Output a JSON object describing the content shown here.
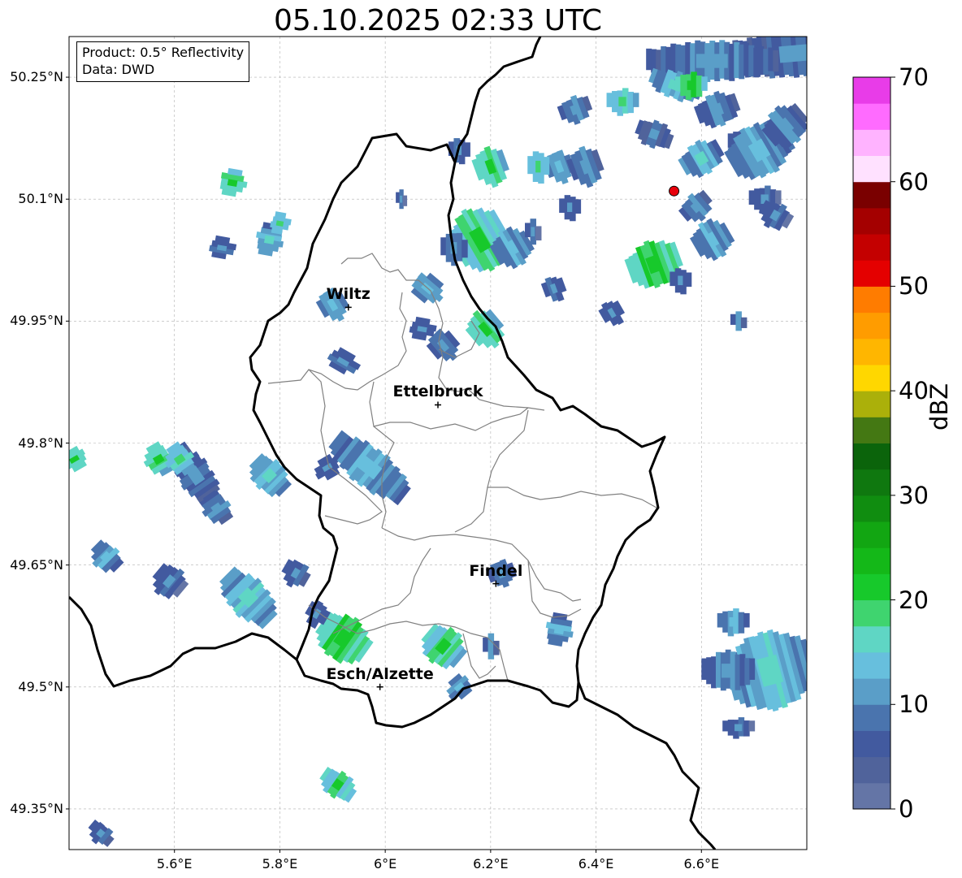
{
  "title": "05.10.2025 02:33 UTC",
  "info": {
    "product_line": "Product: 0.5° Reflectivity",
    "data_line": "Data: DWD"
  },
  "extent": {
    "lon_min": 5.4,
    "lon_max": 6.8,
    "lat_min": 49.3,
    "lat_max": 50.3
  },
  "lat_ticks": [
    {
      "value": 50.25,
      "label": "50.25°N"
    },
    {
      "value": 50.1,
      "label": "50.1°N"
    },
    {
      "value": 49.95,
      "label": "49.95°N"
    },
    {
      "value": 49.8,
      "label": "49.8°N"
    },
    {
      "value": 49.65,
      "label": "49.65°N"
    },
    {
      "value": 49.5,
      "label": "49.5°N"
    },
    {
      "value": 49.35,
      "label": "49.35°N"
    }
  ],
  "lon_ticks": [
    {
      "value": 5.6,
      "label": "5.6°E"
    },
    {
      "value": 5.8,
      "label": "5.8°E"
    },
    {
      "value": 6.0,
      "label": "6°E"
    },
    {
      "value": 6.2,
      "label": "6.2°E"
    },
    {
      "value": 6.4,
      "label": "6.4°E"
    },
    {
      "value": 6.6,
      "label": "6.6°E"
    }
  ],
  "cities": [
    {
      "name": "Wiltz",
      "lon": 5.93,
      "lat": 49.967
    },
    {
      "name": "Ettelbruck",
      "lon": 6.1,
      "lat": 49.847
    },
    {
      "name": "Findel",
      "lon": 6.21,
      "lat": 49.627
    },
    {
      "name": "Esch/Alzette",
      "lon": 5.99,
      "lat": 49.5
    }
  ],
  "radar_site": {
    "lon": 6.548,
    "lat": 50.11,
    "color": "#e8000b"
  },
  "colorbar": {
    "label": "dBZ",
    "min": 0,
    "max": 70,
    "step": 2.5,
    "ticks": [
      {
        "value": 0,
        "label": "0"
      },
      {
        "value": 10,
        "label": "10"
      },
      {
        "value": 20,
        "label": "20"
      },
      {
        "value": 30,
        "label": "30"
      },
      {
        "value": 40,
        "label": "40"
      },
      {
        "value": 50,
        "label": "50"
      },
      {
        "value": 60,
        "label": "60"
      },
      {
        "value": 70,
        "label": "70"
      }
    ],
    "colors": [
      "#6475a6",
      "#50639b",
      "#425a9f",
      "#4a74ae",
      "#5a9ec8",
      "#67bfdd",
      "#5fd6c4",
      "#3fd46f",
      "#17c92b",
      "#14b818",
      "#12a612",
      "#108d10",
      "#0f780f",
      "#0b640b",
      "#447813",
      "#abb00a",
      "#ffd700",
      "#ffb600",
      "#ff9c00",
      "#ff7c00",
      "#e40000",
      "#c40000",
      "#a40000",
      "#7a0000",
      "#ffe1ff",
      "#ffb3ff",
      "#ff6bff",
      "#e83ce8"
    ]
  },
  "radar_echoes": [
    {
      "lon": 6.79,
      "lat": 50.28,
      "len": 0.35,
      "wid": 0.035,
      "ang": 5,
      "dbz": 10
    },
    {
      "lon": 6.62,
      "lat": 50.27,
      "len": 0.25,
      "wid": 0.03,
      "ang": 0,
      "dbz": 12
    },
    {
      "lon": 6.55,
      "lat": 50.24,
      "len": 0.1,
      "wid": 0.02,
      "ang": -20,
      "dbz": 15
    },
    {
      "lon": 6.45,
      "lat": 50.22,
      "len": 0.06,
      "wid": 0.02,
      "ang": 0,
      "dbz": 18
    },
    {
      "lon": 6.36,
      "lat": 50.21,
      "len": 0.06,
      "wid": 0.02,
      "ang": 20,
      "dbz": 12
    },
    {
      "lon": 6.51,
      "lat": 50.18,
      "len": 0.07,
      "wid": 0.02,
      "ang": -20,
      "dbz": 10
    },
    {
      "lon": 6.63,
      "lat": 50.21,
      "len": 0.08,
      "wid": 0.025,
      "ang": 20,
      "dbz": 12
    },
    {
      "lon": 6.58,
      "lat": 50.24,
      "len": 0.06,
      "wid": 0.02,
      "ang": 0,
      "dbz": 22
    },
    {
      "lon": 6.6,
      "lat": 50.15,
      "len": 0.08,
      "wid": 0.025,
      "ang": 30,
      "dbz": 15
    },
    {
      "lon": 6.68,
      "lat": 50.17,
      "len": 0.06,
      "wid": 0.02,
      "ang": 0,
      "dbz": 10
    },
    {
      "lon": 6.71,
      "lat": 50.16,
      "len": 0.12,
      "wid": 0.04,
      "ang": 30,
      "dbz": 14
    },
    {
      "lon": 6.76,
      "lat": 50.19,
      "len": 0.08,
      "wid": 0.03,
      "ang": 40,
      "dbz": 12
    },
    {
      "lon": 6.72,
      "lat": 50.1,
      "len": 0.06,
      "wid": 0.02,
      "ang": 0,
      "dbz": 10
    },
    {
      "lon": 6.74,
      "lat": 50.08,
      "len": 0.06,
      "wid": 0.02,
      "ang": -30,
      "dbz": 10
    },
    {
      "lon": 6.2,
      "lat": 50.14,
      "len": 0.06,
      "wid": 0.03,
      "ang": 20,
      "dbz": 20
    },
    {
      "lon": 6.14,
      "lat": 50.16,
      "len": 0.04,
      "wid": 0.02,
      "ang": 0,
      "dbz": 12
    },
    {
      "lon": 6.33,
      "lat": 50.14,
      "len": 0.05,
      "wid": 0.025,
      "ang": 20,
      "dbz": 14
    },
    {
      "lon": 6.38,
      "lat": 50.14,
      "len": 0.06,
      "wid": 0.03,
      "ang": 20,
      "dbz": 12
    },
    {
      "lon": 6.29,
      "lat": 50.14,
      "len": 0.04,
      "wid": 0.025,
      "ang": 0,
      "dbz": 18
    },
    {
      "lon": 6.35,
      "lat": 50.09,
      "len": 0.04,
      "wid": 0.02,
      "ang": 0,
      "dbz": 10
    },
    {
      "lon": 6.59,
      "lat": 50.09,
      "len": 0.06,
      "wid": 0.02,
      "ang": 40,
      "dbz": 12
    },
    {
      "lon": 6.62,
      "lat": 50.05,
      "len": 0.07,
      "wid": 0.03,
      "ang": 30,
      "dbz": 14
    },
    {
      "lon": 6.51,
      "lat": 50.02,
      "len": 0.1,
      "wid": 0.035,
      "ang": 20,
      "dbz": 22
    },
    {
      "lon": 6.18,
      "lat": 50.05,
      "len": 0.1,
      "wid": 0.05,
      "ang": 30,
      "dbz": 20
    },
    {
      "lon": 6.24,
      "lat": 50.04,
      "len": 0.07,
      "wid": 0.03,
      "ang": 30,
      "dbz": 14
    },
    {
      "lon": 6.13,
      "lat": 50.04,
      "len": 0.05,
      "wid": 0.025,
      "ang": 0,
      "dbz": 12
    },
    {
      "lon": 6.28,
      "lat": 50.06,
      "len": 0.03,
      "wid": 0.02,
      "ang": 0,
      "dbz": 10
    },
    {
      "lon": 6.32,
      "lat": 49.99,
      "len": 0.04,
      "wid": 0.02,
      "ang": 20,
      "dbz": 12
    },
    {
      "lon": 6.43,
      "lat": 49.96,
      "len": 0.04,
      "wid": 0.02,
      "ang": 30,
      "dbz": 10
    },
    {
      "lon": 6.56,
      "lat": 50.0,
      "len": 0.04,
      "wid": 0.02,
      "ang": 0,
      "dbz": 10
    },
    {
      "lon": 6.67,
      "lat": 49.95,
      "len": 0.03,
      "wid": 0.015,
      "ang": 0,
      "dbz": 12
    },
    {
      "lon": 6.03,
      "lat": 50.1,
      "len": 0.02,
      "wid": 0.015,
      "ang": 0,
      "dbz": 10
    },
    {
      "lon": 6.19,
      "lat": 49.94,
      "len": 0.06,
      "wid": 0.03,
      "ang": 40,
      "dbz": 20
    },
    {
      "lon": 6.08,
      "lat": 49.99,
      "len": 0.05,
      "wid": 0.025,
      "ang": 50,
      "dbz": 14
    },
    {
      "lon": 6.11,
      "lat": 49.92,
      "len": 0.05,
      "wid": 0.025,
      "ang": 40,
      "dbz": 12
    },
    {
      "lon": 6.07,
      "lat": 49.94,
      "len": 0.04,
      "wid": 0.02,
      "ang": 80,
      "dbz": 10
    },
    {
      "lon": 5.9,
      "lat": 49.97,
      "len": 0.05,
      "wid": 0.025,
      "ang": 30,
      "dbz": 14
    },
    {
      "lon": 5.92,
      "lat": 49.9,
      "len": 0.04,
      "wid": 0.025,
      "ang": 60,
      "dbz": 12
    },
    {
      "lon": 5.71,
      "lat": 50.12,
      "len": 0.05,
      "wid": 0.02,
      "ang": 80,
      "dbz": 20
    },
    {
      "lon": 5.69,
      "lat": 50.04,
      "len": 0.04,
      "wid": 0.02,
      "ang": 80,
      "dbz": 12
    },
    {
      "lon": 5.78,
      "lat": 50.05,
      "len": 0.06,
      "wid": 0.02,
      "ang": 80,
      "dbz": 15
    },
    {
      "lon": 5.8,
      "lat": 50.07,
      "len": 0.04,
      "wid": 0.015,
      "ang": 80,
      "dbz": 18
    },
    {
      "lon": 5.97,
      "lat": 49.77,
      "len": 0.17,
      "wid": 0.03,
      "ang": -38,
      "dbz": 14
    },
    {
      "lon": 5.78,
      "lat": 49.76,
      "len": 0.08,
      "wid": 0.025,
      "ang": -45,
      "dbz": 16
    },
    {
      "lon": 5.89,
      "lat": 49.77,
      "len": 0.04,
      "wid": 0.02,
      "ang": -60,
      "dbz": 10
    },
    {
      "lon": 5.64,
      "lat": 49.76,
      "len": 0.13,
      "wid": 0.025,
      "ang": -55,
      "dbz": 10
    },
    {
      "lon": 5.57,
      "lat": 49.78,
      "len": 0.06,
      "wid": 0.02,
      "ang": -60,
      "dbz": 20
    },
    {
      "lon": 5.61,
      "lat": 49.78,
      "len": 0.06,
      "wid": 0.02,
      "ang": -55,
      "dbz": 18
    },
    {
      "lon": 5.68,
      "lat": 49.72,
      "len": 0.06,
      "wid": 0.02,
      "ang": -55,
      "dbz": 12
    },
    {
      "lon": 5.41,
      "lat": 49.78,
      "len": 0.04,
      "wid": 0.02,
      "ang": -60,
      "dbz": 20
    },
    {
      "lon": 5.47,
      "lat": 49.66,
      "len": 0.06,
      "wid": 0.02,
      "ang": -45,
      "dbz": 14
    },
    {
      "lon": 5.59,
      "lat": 49.63,
      "len": 0.06,
      "wid": 0.025,
      "ang": -40,
      "dbz": 10
    },
    {
      "lon": 5.74,
      "lat": 49.61,
      "len": 0.12,
      "wid": 0.03,
      "ang": -45,
      "dbz": 16
    },
    {
      "lon": 5.83,
      "lat": 49.64,
      "len": 0.05,
      "wid": 0.02,
      "ang": -30,
      "dbz": 10
    },
    {
      "lon": 5.92,
      "lat": 49.56,
      "len": 0.1,
      "wid": 0.035,
      "ang": -35,
      "dbz": 22
    },
    {
      "lon": 5.87,
      "lat": 49.59,
      "len": 0.04,
      "wid": 0.02,
      "ang": -30,
      "dbz": 10
    },
    {
      "lon": 6.11,
      "lat": 49.55,
      "len": 0.08,
      "wid": 0.03,
      "ang": -40,
      "dbz": 20
    },
    {
      "lon": 6.14,
      "lat": 49.5,
      "len": 0.04,
      "wid": 0.02,
      "ang": -50,
      "dbz": 14
    },
    {
      "lon": 6.22,
      "lat": 49.64,
      "len": 0.05,
      "wid": 0.02,
      "ang": 20,
      "dbz": 12
    },
    {
      "lon": 6.2,
      "lat": 49.55,
      "len": 0.03,
      "wid": 0.02,
      "ang": 0,
      "dbz": 12
    },
    {
      "lon": 6.33,
      "lat": 49.57,
      "len": 0.06,
      "wid": 0.02,
      "ang": 80,
      "dbz": 14
    },
    {
      "lon": 6.66,
      "lat": 49.58,
      "len": 0.06,
      "wid": 0.02,
      "ang": 0,
      "dbz": 14
    },
    {
      "lon": 6.73,
      "lat": 49.52,
      "len": 0.16,
      "wid": 0.06,
      "ang": 15,
      "dbz": 16
    },
    {
      "lon": 6.65,
      "lat": 49.52,
      "len": 0.1,
      "wid": 0.03,
      "ang": 0,
      "dbz": 12
    },
    {
      "lon": 6.67,
      "lat": 49.45,
      "len": 0.06,
      "wid": 0.015,
      "ang": 0,
      "dbz": 10
    },
    {
      "lon": 5.91,
      "lat": 49.38,
      "len": 0.07,
      "wid": 0.02,
      "ang": -35,
      "dbz": 20
    },
    {
      "lon": 5.46,
      "lat": 49.32,
      "len": 0.05,
      "wid": 0.015,
      "ang": -40,
      "dbz": 10
    }
  ]
}
